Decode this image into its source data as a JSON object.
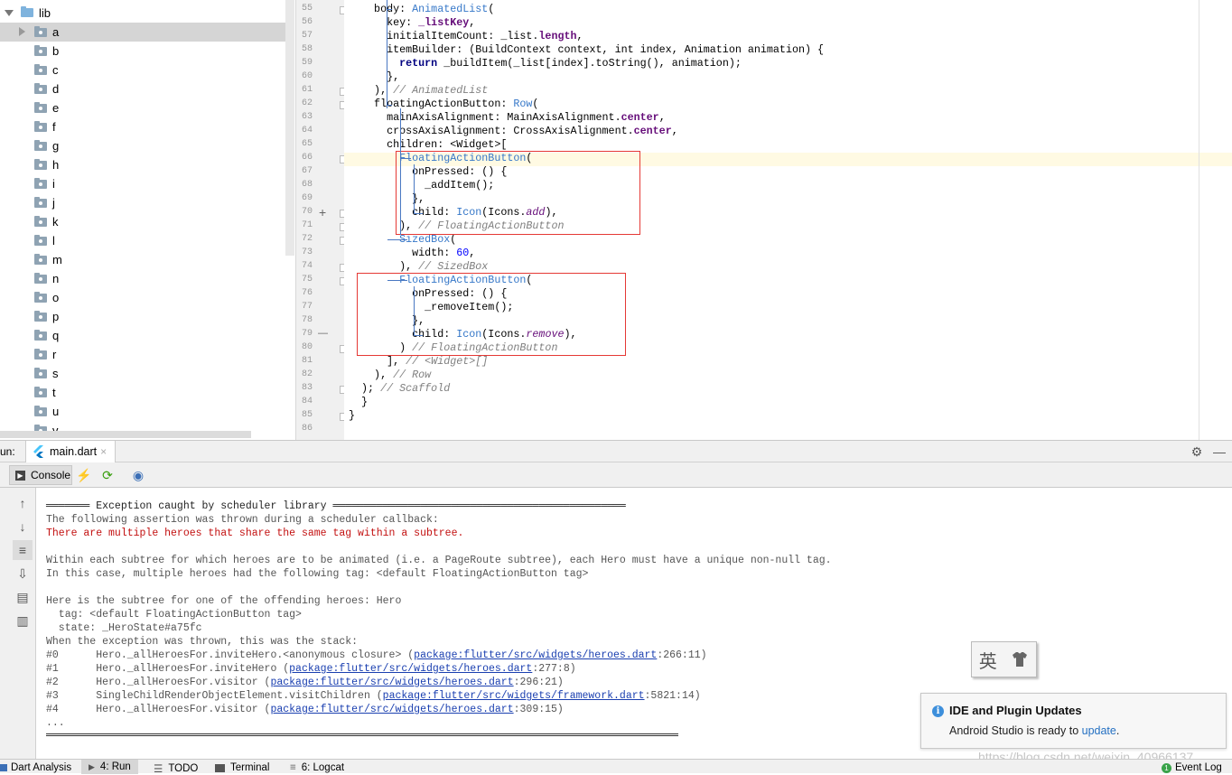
{
  "project_tree": {
    "root_label": "lib",
    "items": [
      "a",
      "b",
      "c",
      "d",
      "e",
      "f",
      "g",
      "h",
      "i",
      "j",
      "k",
      "l",
      "m",
      "n",
      "o",
      "p",
      "q",
      "r",
      "s",
      "t",
      "u",
      "v"
    ],
    "selected": "a"
  },
  "editor": {
    "line_numbers": [
      "55",
      "56",
      "57",
      "58",
      "59",
      "60",
      "61",
      "62",
      "63",
      "64",
      "65",
      "66",
      "67",
      "68",
      "69",
      "70",
      "71",
      "72",
      "73",
      "74",
      "75",
      "76",
      "77",
      "78",
      "79",
      "80",
      "81",
      "82",
      "83",
      "84",
      "85",
      "86"
    ],
    "lines": [
      "    body: AnimatedList(",
      "      key: _listKey,",
      "      initialItemCount: _list.length,",
      "      itemBuilder: (BuildContext context, int index, Animation animation) {",
      "        return _buildItem(_list[index].toString(), animation);",
      "      },",
      "    ), // AnimatedList",
      "    floatingActionButton: Row(",
      "      mainAxisAlignment: MainAxisAlignment.center,",
      "      crossAxisAlignment: CrossAxisAlignment.center,",
      "      children: <Widget>[",
      "        FloatingActionButton(",
      "          onPressed: () {",
      "            _addItem();",
      "          },",
      "          child: Icon(Icons.add),",
      "        ), // FloatingActionButton",
      "        SizedBox(",
      "          width: 60,",
      "        ), // SizedBox",
      "        FloatingActionButton(",
      "          onPressed: () {",
      "            _removeItem();",
      "          },",
      "          child: Icon(Icons.remove),",
      "        ) // FloatingActionButton",
      "      ], // <Widget>[]",
      "    ), // Row",
      "  ); // Scaffold",
      "  }",
      "}",
      ""
    ]
  },
  "run_panel": {
    "run_label": "un:",
    "tab_file": "main.dart",
    "console_tab": "Console"
  },
  "console": {
    "header": "═══════ Exception caught by scheduler library ═══════════════════════════════════════════════",
    "line1": "The following assertion was thrown during a scheduler callback:",
    "line2": "There are multiple heroes that share the same tag within a subtree.",
    "line3": "Within each subtree for which heroes are to be animated (i.e. a PageRoute subtree), each Hero must have a unique non-null tag.",
    "line4": "In this case, multiple heroes had the following tag: <default FloatingActionButton tag>",
    "line5": "Here is the subtree for one of the offending heroes: Hero",
    "line6": "  tag: <default FloatingActionButton tag>",
    "line7": "  state: _HeroState#a75fc",
    "line8": "When the exception was thrown, this was the stack:",
    "stack": [
      {
        "num": "#0",
        "pre": "      Hero._allHeroesFor.inviteHero.<anonymous closure> (",
        "link": "package:flutter/src/widgets/heroes.dart",
        "post": ":266:11)"
      },
      {
        "num": "#1",
        "pre": "      Hero._allHeroesFor.inviteHero (",
        "link": "package:flutter/src/widgets/heroes.dart",
        "post": ":277:8)"
      },
      {
        "num": "#2",
        "pre": "      Hero._allHeroesFor.visitor (",
        "link": "package:flutter/src/widgets/heroes.dart",
        "post": ":296:21)"
      },
      {
        "num": "#3",
        "pre": "      SingleChildRenderObjectElement.visitChildren (",
        "link": "package:flutter/src/widgets/framework.dart",
        "post": ":5821:14)"
      },
      {
        "num": "#4",
        "pre": "      Hero._allHeroesFor.visitor (",
        "link": "package:flutter/src/widgets/heroes.dart",
        "post": ":309:15)"
      }
    ],
    "ellipsis": "..."
  },
  "notification": {
    "title": "IDE and Plugin Updates",
    "body": "Android Studio is ready to ",
    "link": "update",
    "period": "."
  },
  "ime": {
    "char": "英"
  },
  "statusbar": {
    "dart_analysis": "Dart Analysis",
    "run": "4: Run",
    "todo": "TODO",
    "terminal": "Terminal",
    "logcat": "6: Logcat",
    "event_log": "Event Log",
    "event_count": "1"
  },
  "watermark": "https://blog.csdn.net/weixin_40966137",
  "colors": {
    "accent": "#3577c8",
    "error": "#c31010",
    "link": "#1a3fb0",
    "box": "#e53935"
  }
}
